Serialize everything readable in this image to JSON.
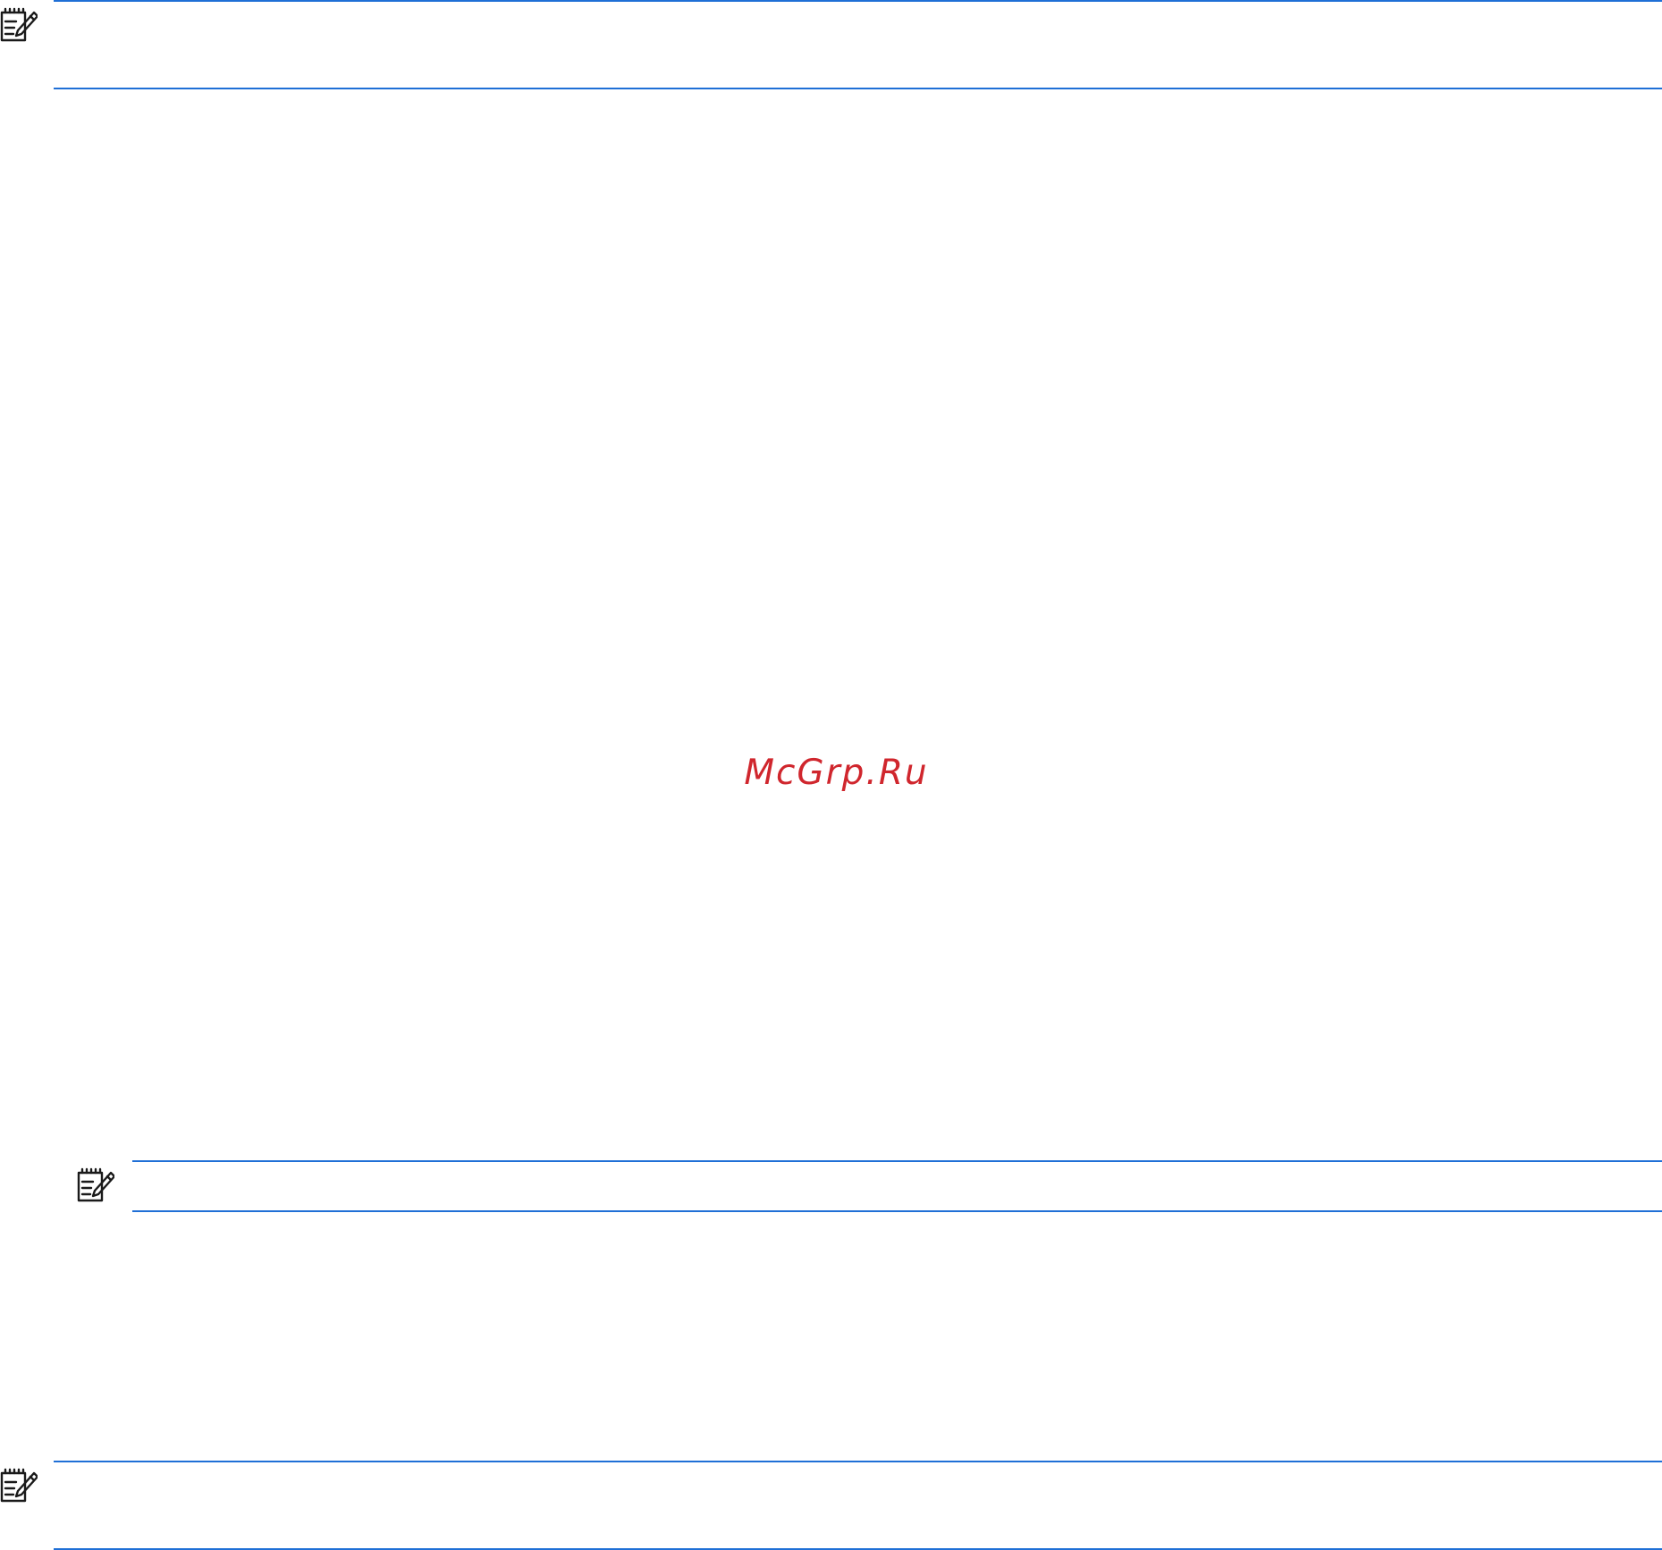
{
  "watermark": {
    "text": "McGrp.Ru"
  },
  "colors": {
    "rule": "#1f6fd6",
    "watermark": "#d0262d",
    "icon": "#1a1a1a"
  },
  "notes": [
    {
      "icon": "note-pad-icon"
    },
    {
      "icon": "note-pad-icon"
    },
    {
      "icon": "note-pad-icon"
    }
  ]
}
